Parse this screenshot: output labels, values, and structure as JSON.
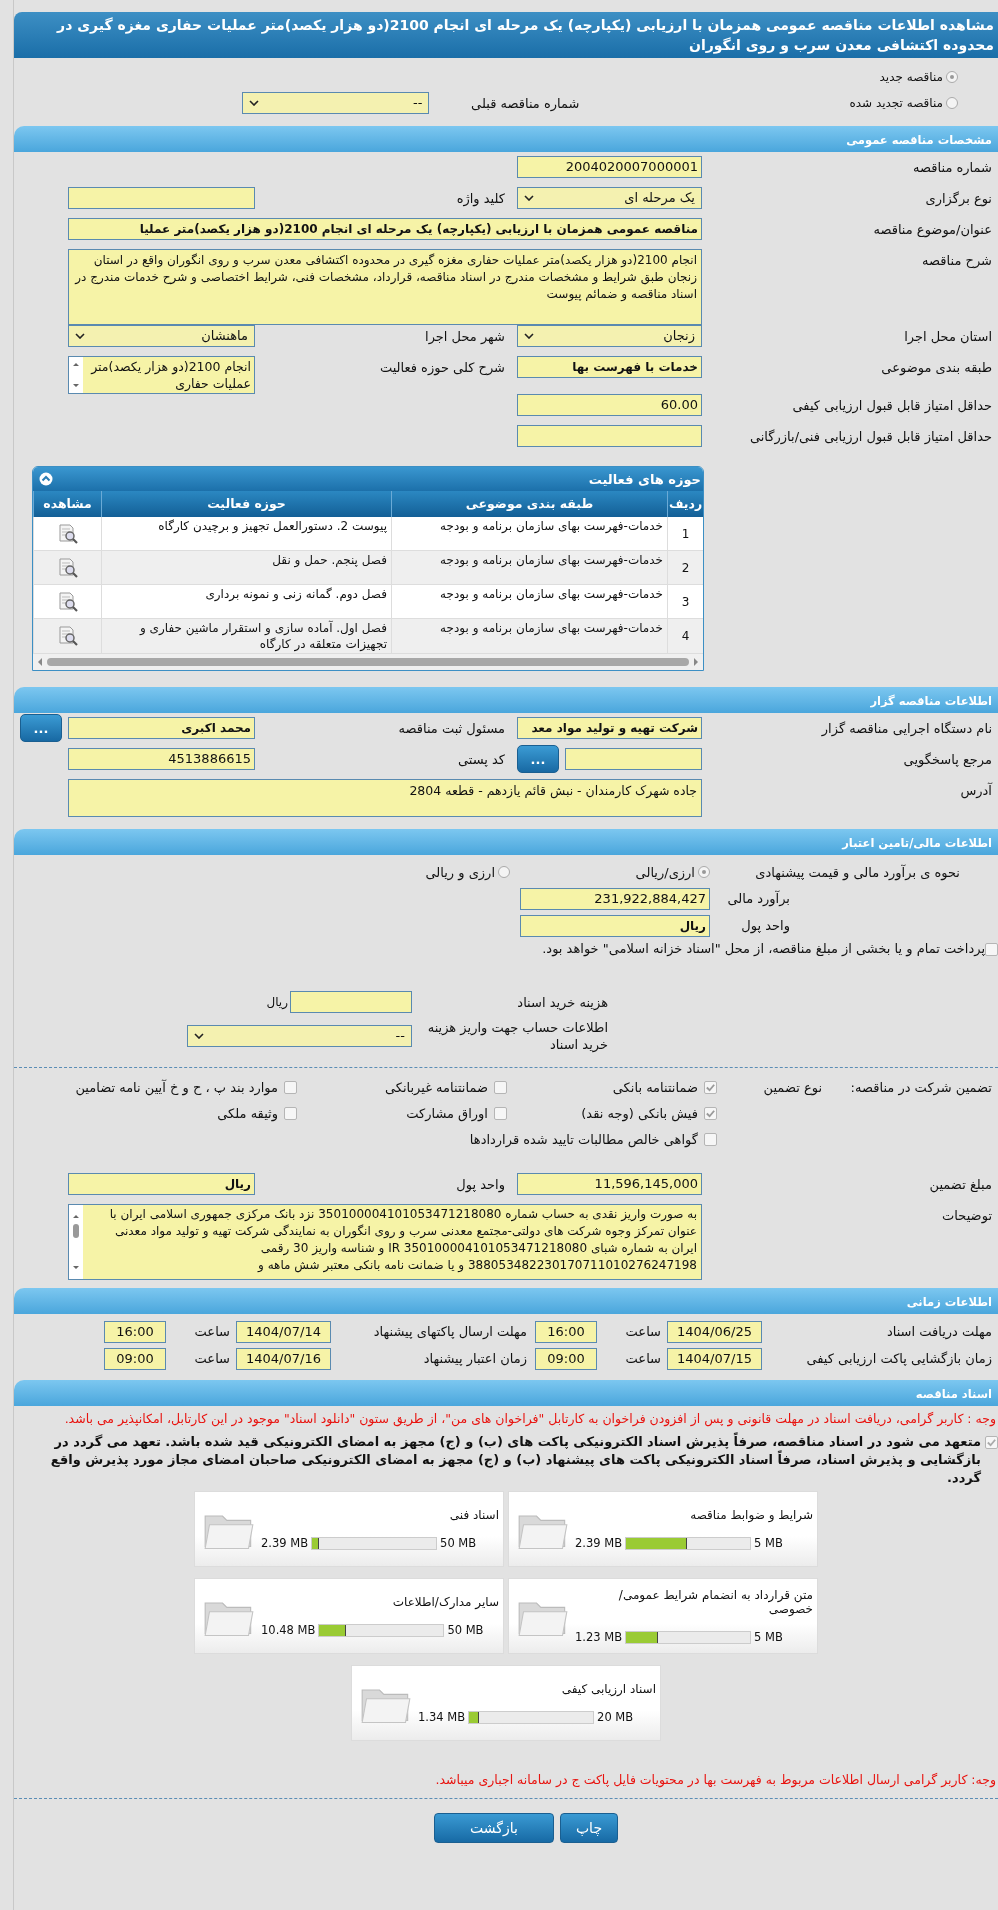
{
  "title": "مشاهده اطلاعات مناقصه عمومی همزمان با ارزیابی (یکپارچه) یک مرحله ای انجام 2100(دو هزار یکصد)متر عملیات حفاری مغزه گیری در محدوده اکتشافی معدن سرب و روی انگوران",
  "tender_type": [
    {
      "label": "مناقصه جدید",
      "selected": true
    },
    {
      "label": "مناقصه تجدید شده",
      "selected": false
    }
  ],
  "previous_tender": {
    "label": "شماره مناقصه قبلی",
    "value": "--"
  },
  "general": {
    "header": "مشخصات مناقصه عمومی",
    "rows": [
      {
        "cells": [
          {
            "label": "شماره مناقصه",
            "kind": "input",
            "value": "2004020007000001",
            "bold": false
          }
        ]
      },
      {
        "cells": [
          {
            "label": "نوع برگزاری",
            "kind": "select",
            "value": "یک مرحله ای"
          },
          {
            "label": "کلید واژه",
            "kind": "input"
          }
        ]
      },
      {
        "cells": [
          {
            "label": "عنوان/موضوع مناقصه",
            "kind": "wide",
            "value": "مناقصه عمومی همزمان با ارزیابی (یکپارچه) یک مرحله ای انجام 2100(دو هزار یکصد)متر عملیا",
            "bold": true
          }
        ]
      },
      {
        "cells": [
          {
            "label": "شرح مناقصه",
            "kind": "textarea",
            "value": "انجام 2100(دو هزار یکصد)متر عملیات حفاری مغزه گیری در محدوده اکتشافی معدن سرب و روی انگوران واقع در استان زنجان طبق شرایط و مشخصات مندرج در اسناد مناقصه، قرارداد، مشخصات فنی، شرایط اختصاصی و شرح خدمات مندرج در اسناد مناقصه و ضمائم پیوست"
          }
        ]
      },
      {
        "cells": [
          {
            "label": "استان محل اجرا",
            "kind": "select",
            "value": "زنجان"
          },
          {
            "label": "شهر محل اجرا",
            "kind": "select",
            "value": "ماهنشان"
          }
        ]
      },
      {
        "cells": [
          {
            "label": "طبقه بندی موضوعی",
            "kind": "input",
            "value": "خدمات با فهرست بها",
            "bold": true
          },
          {
            "label": "شرح کلی حوزه فعالیت",
            "kind": "listbox",
            "value": "انجام 2100(دو هزار یکصد)متر عملیات حفاری"
          }
        ]
      },
      {
        "cells": [
          {
            "label": "حداقل امتیاز قابل قبول ارزیابی کیفی",
            "kind": "input",
            "value": "60.00",
            "bold": false
          }
        ]
      },
      {
        "cells": [
          {
            "label": "حداقل امتیاز قابل قبول ارزیابی فنی/بازرگانی",
            "kind": "input"
          }
        ]
      }
    ]
  },
  "activities": {
    "title": "حوزه های فعالیت",
    "columns": [
      "ردیف",
      "طبقه بندی موضوعی",
      "حوزه فعالیت",
      "مشاهده"
    ],
    "rows": [
      {
        "index": "1",
        "category": "خدمات-فهرست بهای سازمان برنامه و بودجه",
        "activity": "پیوست 2. دستورالعمل تجهیز و برچیدن کارگاه"
      },
      {
        "index": "2",
        "category": "خدمات-فهرست بهای سازمان برنامه و بودجه",
        "activity": "فصل پنجم. حمل و نقل"
      },
      {
        "index": "3",
        "category": "خدمات-فهرست بهای سازمان برنامه و بودجه",
        "activity": "فصل دوم. گمانه زنی و نمونه برداری"
      },
      {
        "index": "4",
        "category": "خدمات-فهرست بهای سازمان برنامه و بودجه",
        "activity": "فصل اول. آماده سازی و  استقرار ماشین حفاری و تجهیزات متعلقه در کارگاه"
      }
    ]
  },
  "organizer": {
    "header": "اطلاعات مناقصه گزار",
    "rows": [
      {
        "cells": [
          {
            "label": "نام دستگاه اجرایی مناقصه گزار",
            "kind": "input",
            "value": "شرکت تهیه و تولید مواد معد",
            "bold": true
          },
          {
            "label": "مسئول ثبت مناقصه",
            "kind": "input",
            "value": "محمد اکبری",
            "bold": true,
            "button": "..."
          }
        ]
      },
      {
        "cells": [
          {
            "label": "مرجع پاسخگویی",
            "kind": "input",
            "button": "..."
          },
          {
            "label": "کد پستی",
            "kind": "input",
            "value": "4513886615",
            "bold": false
          }
        ]
      },
      {
        "cells": [
          {
            "label": "آدرس",
            "kind": "address",
            "value": "جاده شهرک کارمندان - نبش قائم یازدهم - قطعه 2804"
          }
        ]
      }
    ]
  },
  "finance": {
    "header": "اطلاعات مالی/تامین اعتبار",
    "estimate_method": {
      "label": "نحوه ی برآورد مالی و قیمت پیشنهادی",
      "options": [
        {
          "label": "ارزی/ریالی",
          "selected": true
        },
        {
          "label": "ارزی و ریالی",
          "selected": false
        }
      ]
    },
    "estimate": {
      "label": "برآورد مالی",
      "value": "231,922,884,427"
    },
    "currency": {
      "label": "واحد پول",
      "value": "ریال"
    },
    "treasury": {
      "label": "پرداخت تمام و یا بخشی از مبلغ مناقصه، از محل \"اسناد خزانه اسلامی\" خواهد بود.",
      "checked": false
    },
    "document_fee": {
      "label": "هزینه خرید اسناد",
      "unit": "ریال"
    },
    "account": {
      "label": "اطلاعات حساب جهت واریز هزینه خرید اسناد",
      "value": "--"
    }
  },
  "guarantee": {
    "label": "تضمین شرکت در مناقصه:",
    "type_label": "نوع تضمین",
    "options": [
      {
        "label": "ضمانتنامه بانکی",
        "checked": true
      },
      {
        "label": "ضمانتنامه غیربانکی",
        "checked": false
      },
      {
        "label": "موارد بند پ ، ح و خ آیین نامه تضامین",
        "checked": false
      },
      {
        "label": "فیش بانکی (وجه نقد)",
        "checked": true
      },
      {
        "label": "اوراق مشارکت",
        "checked": false
      },
      {
        "label": "وثیقه ملکی",
        "checked": false
      },
      {
        "label": "گواهی خالص مطالبات تایید شده قراردادها",
        "checked": false
      }
    ],
    "amount": {
      "label": "مبلغ تضمین",
      "value": "11,596,145,000"
    },
    "currency": {
      "label": "واحد پول",
      "value": "ریال"
    },
    "description": {
      "label": "توضیحات",
      "value": "به صورت واریز نقدی به حساب شماره 350100004101053471218080 نزد بانک مرکزی جمهوری اسلامی ایران با عنوان تمرکز وجوه شرکت های دولتی-مجتمع معدنی سرب و روی انگوران به نمایندگی شرکت تهیه و تولید مواد معدنی ایران به شماره شبای IR 350100004101053471218080 و شناسه واریز 30 رقمی 388053482230170711010276247198 و یا ضمانت نامه بانکی معتبر شش ماهه و"
    }
  },
  "timing": {
    "header": "اطلاعات زمانی",
    "rows": [
      {
        "cells": [
          {
            "label": "مهلت دریافت اسناد",
            "date": "1404/06/25",
            "time_label": "ساعت",
            "time": "16:00"
          },
          {
            "label": "مهلت ارسال پاکتهای پیشنهاد",
            "date": "1404/07/14",
            "time_label": "ساعت",
            "time": "16:00"
          }
        ]
      },
      {
        "cells": [
          {
            "label": "زمان بازگشایی پاکت ارزیابی کیفی",
            "date": "1404/07/15",
            "time_label": "ساعت",
            "time": "09:00"
          },
          {
            "label": "زمان اعتبار پیشنهاد",
            "date": "1404/07/16",
            "time_label": "ساعت",
            "time": "09:00"
          }
        ]
      }
    ]
  },
  "documents": {
    "header": "اسناد مناقصه",
    "note": "وجه : کاربر گرامی، دریافت اسناد در مهلت قانونی و پس از افزودن فراخوان به کارتابل \"فراخوان های من\"، از طریق ستون \"دانلود اسناد\" موجود در این کارتابل، امکانپذیر می باشد.",
    "commitment": {
      "text": "متعهد می شود در اسناد مناقصه، صرفاً پذیرش اسناد الکترونیکی پاکت های (ب) و (ج) مجهز به امضای الکترونیکی قید شده باشد. تعهد می گردد در بازگشایی و پذیرش اسناد، صرفاً اسناد الکترونیکی پاکت های پیشنهاد (ب) و (ج) مجهز به امضای الکترونیکی صاحبان امضای مجاز مورد پذیرش واقع گردد.",
      "checked": true
    },
    "files": [
      {
        "title": "شرایط و ضوابط مناقصه",
        "used": "2.39 MB",
        "max": "5 MB",
        "level": 0.48
      },
      {
        "title": "اسناد فنی",
        "used": "2.39 MB",
        "max": "50 MB",
        "level": 0.05
      },
      {
        "title": "متن قرارداد به انضمام شرایط عمومی/خصوصی",
        "used": "1.23 MB",
        "max": "5 MB",
        "level": 0.25
      },
      {
        "title": "سایر مدارک/اطلاعات",
        "used": "10.48 MB",
        "max": "50 MB",
        "level": 0.21
      },
      {
        "title": "اسناد ارزیابی کیفی",
        "used": "1.34 MB",
        "max": "20 MB",
        "level": 0.07
      }
    ],
    "footer_note": "وجه: کاربر گرامی ارسال اطلاعات مربوط به فهرست بها در محتویات فایل پاکت ج در سامانه اجباری میباشد."
  },
  "buttons": [
    {
      "label": "چاپ",
      "kind": "print"
    },
    {
      "label": "بازگشت",
      "kind": "back"
    }
  ]
}
